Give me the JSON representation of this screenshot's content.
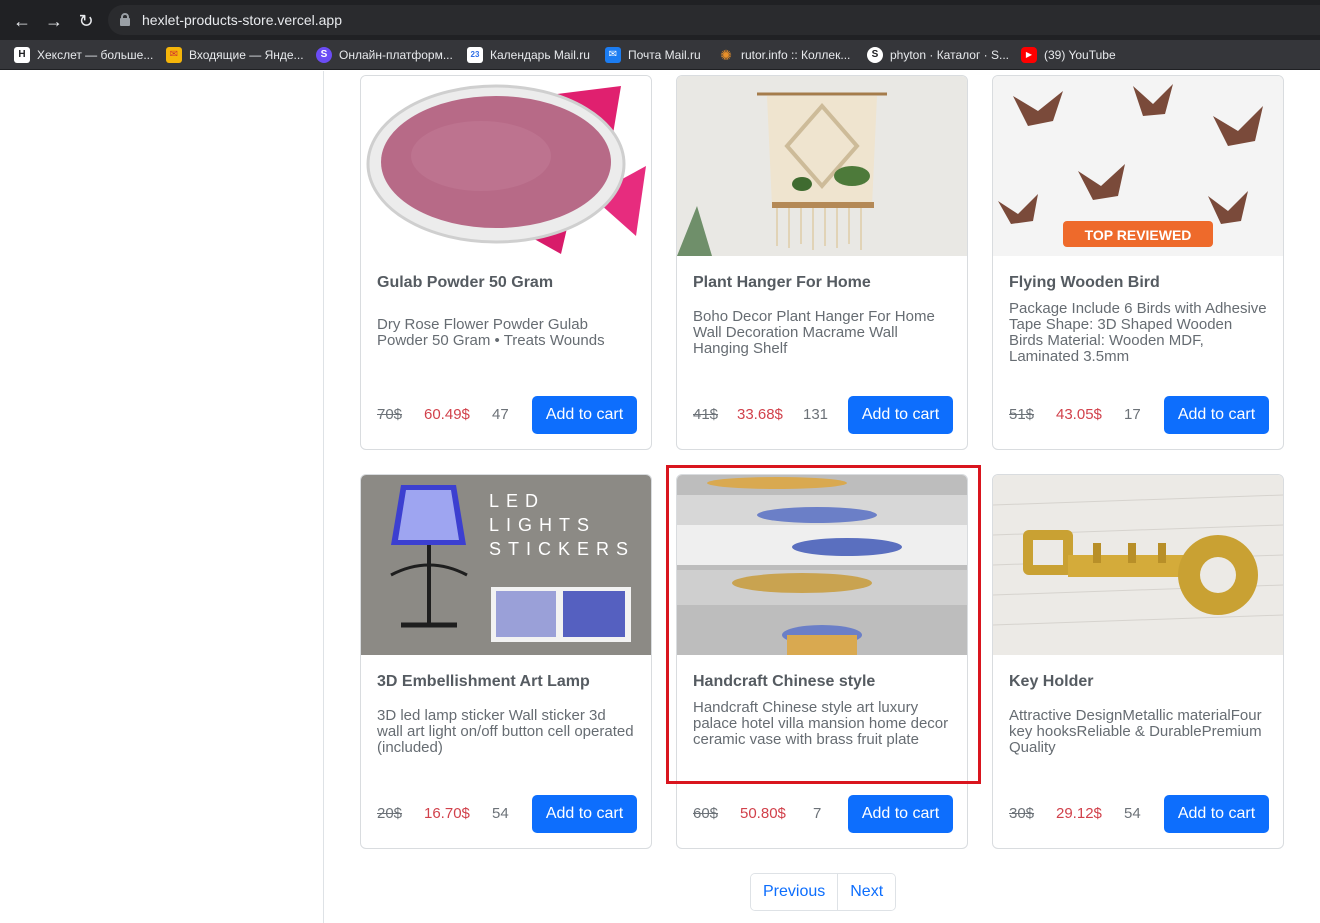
{
  "browser": {
    "url": "hexlet-products-store.vercel.app",
    "bookmarks": [
      {
        "label": "Хекслет — больше...",
        "icon": "hexlet-icon",
        "color": "#ffffff"
      },
      {
        "label": "Входящие — Янде...",
        "icon": "yandex-mail-icon",
        "color": "#f5b50a"
      },
      {
        "label": "Онлайн-платформ...",
        "icon": "skillbox-icon",
        "color": "#6b4cf5"
      },
      {
        "label": "Календарь Mail.ru",
        "icon": "calendar-icon",
        "color": "#2f6fe6"
      },
      {
        "label": "Почта Mail.ru",
        "icon": "mail-ru-icon",
        "color": "#1c7df2"
      },
      {
        "label": "rutor.info :: Коллек...",
        "icon": "rutor-icon",
        "color": "#e8902a"
      },
      {
        "label": "phyton · Каталог · S...",
        "icon": "stepik-icon",
        "color": "#ffffff"
      },
      {
        "label": "(39) YouTube",
        "icon": "youtube-icon",
        "color": "#ff0000"
      }
    ]
  },
  "cart_label": "Add to cart",
  "products": [
    {
      "title": "Gulab Powder 50 Gram",
      "description": "Dry Rose Flower Powder Gulab Powder 50 Gram • Treats Wounds",
      "old_price": "70$",
      "price": "60.49$",
      "stock": "47",
      "image": "pink-powder-image"
    },
    {
      "title": "Plant Hanger For Home",
      "description": "Boho Decor Plant Hanger For Home Wall Decoration Macrame Wall Hanging Shelf",
      "old_price": "41$",
      "price": "33.68$",
      "stock": "131",
      "image": "macrame-hanger-image"
    },
    {
      "title": "Flying Wooden Bird",
      "description": "Package Include 6 Birds with Adhesive Tape Shape: 3D Shaped Wooden Birds Material: Wooden MDF, Laminated 3.5mm",
      "old_price": "51$",
      "price": "43.05$",
      "stock": "17",
      "image": "wooden-birds-image",
      "badge": "TOP REVIEWED"
    },
    {
      "title": "3D Embellishment Art Lamp",
      "description": "3D led lamp sticker Wall sticker 3d wall art light on/off button cell operated (included)",
      "old_price": "20$",
      "price": "16.70$",
      "stock": "54",
      "image": "lamp-sticker-image",
      "image_text": [
        "LED",
        "LIGHTS",
        "STICKERS"
      ]
    },
    {
      "title": "Handcraft Chinese style",
      "description": "Handcraft Chinese style art luxury palace hotel villa mansion home decor ceramic vase with brass fruit plate",
      "old_price": "60$",
      "price": "50.80$",
      "stock": "7",
      "image": "ceramic-vase-image"
    },
    {
      "title": "Key Holder",
      "description": "Attractive DesignMetallic materialFour key hooksReliable & DurablePremium Quality",
      "old_price": "30$",
      "price": "29.12$",
      "stock": "54",
      "image": "key-holder-image"
    }
  ],
  "pagination": {
    "previous": "Previous",
    "next": "Next"
  }
}
